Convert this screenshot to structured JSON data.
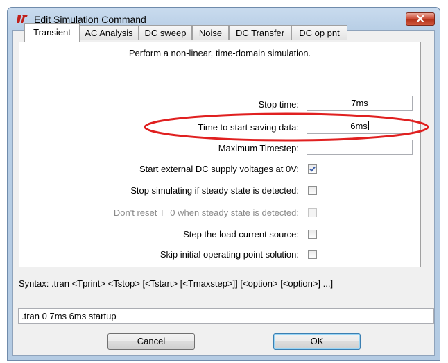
{
  "window": {
    "title": "Edit Simulation Command"
  },
  "tabs": [
    {
      "label": "Transient",
      "active": true
    },
    {
      "label": "AC Analysis",
      "active": false
    },
    {
      "label": "DC sweep",
      "active": false
    },
    {
      "label": "Noise",
      "active": false
    },
    {
      "label": "DC Transfer",
      "active": false
    },
    {
      "label": "DC op pnt",
      "active": false
    }
  ],
  "transient": {
    "description": "Perform a non-linear, time-domain simulation.",
    "stop_time": {
      "label": "Stop time:",
      "value": "7ms"
    },
    "start_saving": {
      "label": "Time to start saving data:",
      "value": "6ms"
    },
    "max_timestep": {
      "label": "Maximum Timestep:",
      "value": ""
    },
    "options": [
      {
        "label": "Start external DC supply voltages at 0V:",
        "checked": true,
        "enabled": true
      },
      {
        "label": "Stop simulating if steady state is detected:",
        "checked": false,
        "enabled": true
      },
      {
        "label": "Don't reset T=0 when steady state is detected:",
        "checked": false,
        "enabled": false
      },
      {
        "label": "Step the load current source:",
        "checked": false,
        "enabled": true
      },
      {
        "label": "Skip initial operating point solution:",
        "checked": false,
        "enabled": true
      }
    ]
  },
  "syntax": "Syntax:  .tran <Tprint> <Tstop> [<Tstart> [<Tmaxstep>]] [<option> [<option>] ...]",
  "command": ".tran 0 7ms 6ms startup",
  "buttons": {
    "cancel": "Cancel",
    "ok": "OK"
  },
  "colors": {
    "annotation": "#e02020",
    "checkmark": "#3c5fa8",
    "titlebar": "#b9cfe6"
  },
  "icons": {
    "app": "ltspice-logo-icon",
    "close": "close-icon",
    "check": "checkmark-icon"
  }
}
